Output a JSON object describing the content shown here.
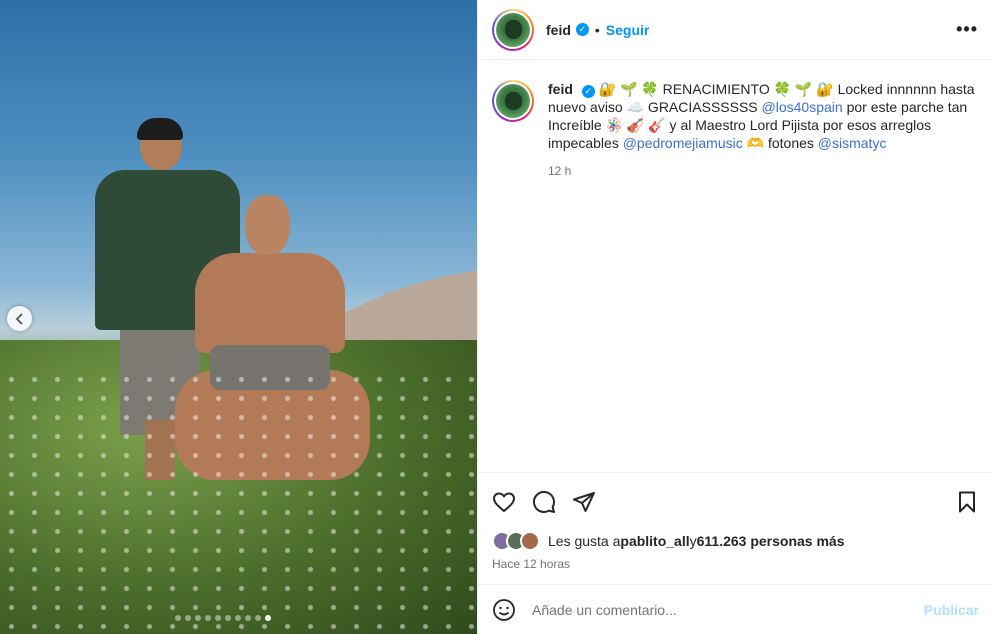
{
  "post": {
    "dots_count": 10,
    "active_dot": 9
  },
  "header": {
    "username": "feid",
    "separator": "•",
    "follow_label": "Seguir",
    "more_label": "•••"
  },
  "caption": {
    "username": "feid",
    "parts": {
      "p1": "🔐 🌱 🍀 RENACIMIENTO 🍀 🌱 🔐 Locked innnnnn hasta nuevo aviso ☁️ GRACIASSSSSS ",
      "mention1": "@los40spain",
      "p2": " por este parche tan Increíble 🪅 🎻 🎸 y al Maestro Lord Pijista por esos arreglos impecables ",
      "mention2": "@pedromejiamusic",
      "p3": " 🫶 fotones ",
      "mention3": "@sismatyc"
    },
    "time": "12 h"
  },
  "actions": {
    "like_icon": "heart-icon",
    "comment_icon": "comment-icon",
    "share_icon": "send-icon",
    "save_icon": "bookmark-icon"
  },
  "likes": {
    "prefix": "Les gusta a ",
    "user": "pablito_all",
    "middle": " y ",
    "count": "611.263 personas más"
  },
  "ago": "Hace 12 horas",
  "comment": {
    "placeholder": "Añade un comentario...",
    "publish_label": "Publicar"
  },
  "colors": {
    "accent": "#0095f6",
    "mention": "#3b6fd0",
    "muted": "#737373"
  }
}
